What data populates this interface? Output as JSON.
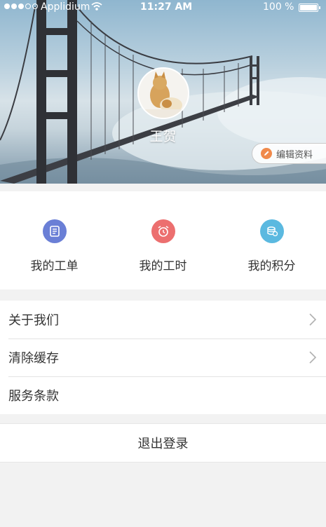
{
  "status_bar": {
    "carrier": "Applidium",
    "time": "11:27 AM",
    "battery": "100 %"
  },
  "profile": {
    "name": "王贺",
    "edit_label": "编辑资料"
  },
  "quick_actions": [
    {
      "label": "我的工单",
      "icon": "work-order-icon",
      "color": "#6a7fd6"
    },
    {
      "label": "我的工时",
      "icon": "alarm-clock-icon",
      "color": "#ec6f6f"
    },
    {
      "label": "我的积分",
      "icon": "coins-icon",
      "color": "#5bb9e0"
    }
  ],
  "menu": {
    "items": [
      {
        "label": "关于我们",
        "has_chevron": true
      },
      {
        "label": "清除缓存",
        "has_chevron": true
      },
      {
        "label": "服务条款",
        "has_chevron": false
      }
    ]
  },
  "logout_label": "退出登录"
}
